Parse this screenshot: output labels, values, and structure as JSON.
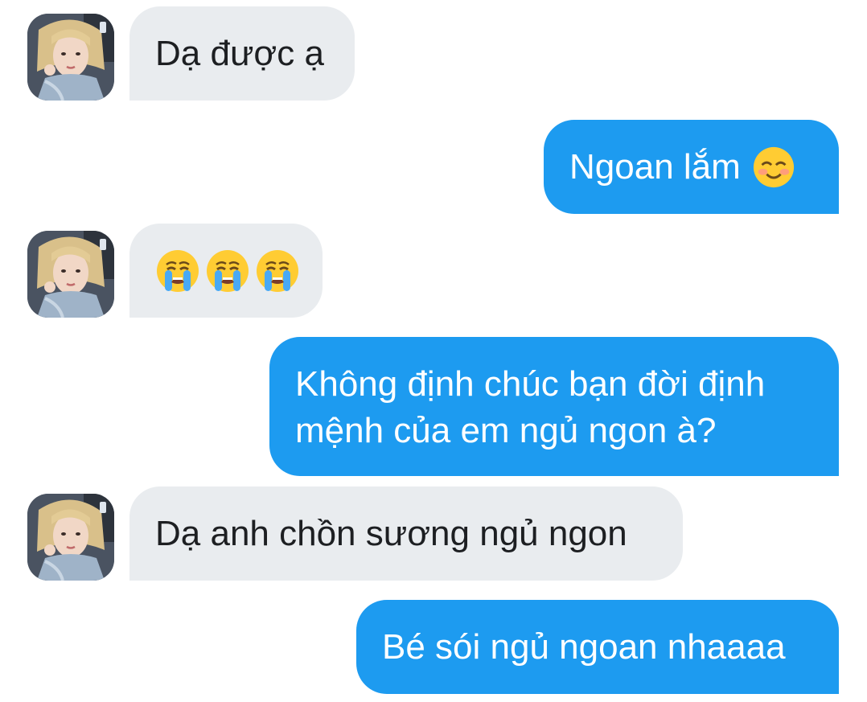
{
  "conversation": {
    "messages": [
      {
        "side": "incoming",
        "text": "Dạ được ạ"
      },
      {
        "side": "outgoing",
        "text": "Ngoan lắm",
        "emoji": "smiling-face-with-smiling-eyes-emoji"
      },
      {
        "side": "incoming",
        "emojis": [
          "loudly-crying-face-emoji",
          "loudly-crying-face-emoji",
          "loudly-crying-face-emoji"
        ]
      },
      {
        "side": "outgoing",
        "lines": [
          "Không định chúc bạn đời định",
          "mệnh của em ngủ ngon à?"
        ]
      },
      {
        "side": "incoming",
        "text": "Dạ anh chồn sương ngủ ngon"
      },
      {
        "side": "outgoing",
        "text": "Bé sói ngủ ngoan nhaaaa"
      }
    ]
  },
  "colors": {
    "incoming_bubble": "#e9ecef",
    "outgoing_bubble": "#1d9bf0",
    "incoming_text": "#1d1f22",
    "outgoing_text": "#ffffff"
  }
}
